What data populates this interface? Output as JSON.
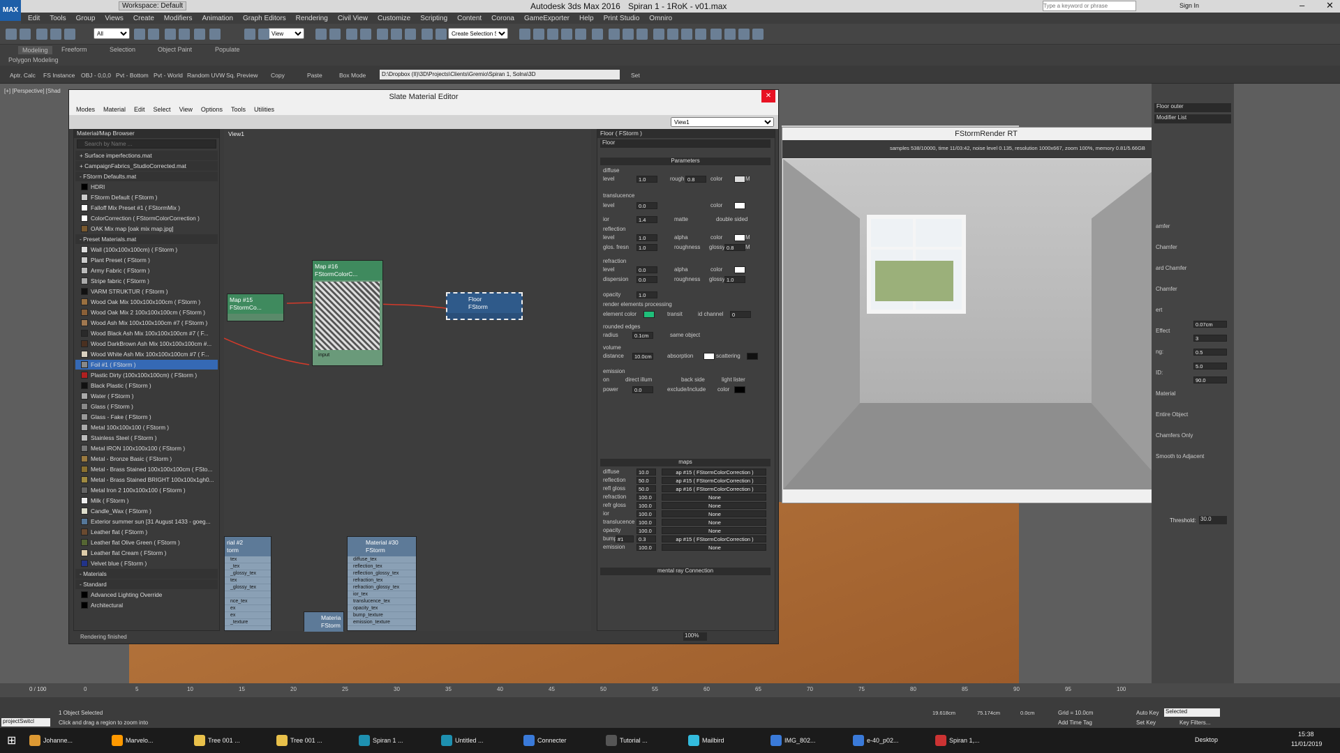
{
  "app": {
    "title": "Autodesk 3ds Max 2016",
    "file": "Spiran 1 - 1RoK - v01.max",
    "workspace": "Workspace: Default",
    "search_placeholder": "Type a keyword or phrase",
    "sign_in": "Sign In",
    "logo": "MAX"
  },
  "menubar": [
    "Edit",
    "Tools",
    "Group",
    "Views",
    "Create",
    "Modifiers",
    "Animation",
    "Graph Editors",
    "Rendering",
    "Civil View",
    "Customize",
    "Scripting",
    "Content",
    "Corona",
    "GameExporter",
    "Help",
    "Print Studio",
    "Omniro"
  ],
  "toolbar": {
    "selection_filter": "All",
    "view_dropdown": "View",
    "named_selection": "Create Selection Se"
  },
  "ribbon": {
    "tabs": [
      "Modeling",
      "Freeform",
      "Selection",
      "Object Paint",
      "Populate"
    ],
    "sub": "Polygon Modeling"
  },
  "cmdbar": {
    "items": [
      "Aptr. Calc",
      "FS Instance",
      "OBJ - 0,0,0",
      "Pvt - Bottom",
      "Pvt - World",
      "Random UVW",
      "Sq. Preview",
      "Copy",
      "Paste",
      "Box Mode"
    ],
    "path": "D:\\Dropbox (II)\\3D\\Projects\\Clients\\Gremio\\Spiran 1, Solna\\3D",
    "set": "Set"
  },
  "viewport": {
    "label": "[+] [Perspective] [Shad"
  },
  "sme": {
    "title": "Slate Material Editor",
    "menu": [
      "Modes",
      "Material",
      "Edit",
      "Select",
      "View",
      "Options",
      "Tools",
      "Utilities"
    ],
    "view_dropdown": "View1",
    "browser_title": "Material/Map Browser",
    "search": "Search by Name ...",
    "view_tab": "View1",
    "status": "Rendering finished",
    "zoom": "100%",
    "browser_rows": [
      {
        "label": "+ Surface imperfections.mat",
        "type": "group"
      },
      {
        "label": "+ CampaignFabrics_StudioCorrected.mat",
        "type": "group"
      },
      {
        "label": "- FStorm Defaults.mat",
        "type": "group"
      },
      {
        "label": "HDRI",
        "type": "item",
        "color": "#000000"
      },
      {
        "label": "FStorm Default  ( FStorm )",
        "type": "item",
        "color": "#cccccc"
      },
      {
        "label": "Falloff Mix Preset #1  ( FStormMix )",
        "type": "item",
        "color": "#ffffff"
      },
      {
        "label": "ColorCorrection  ( FStormColorCorrection )",
        "type": "item",
        "color": "#ffffff"
      },
      {
        "label": "OAK Mix map [oak mix map.jpg]",
        "type": "item",
        "color": "#7a5a30"
      },
      {
        "label": "- Preset Materials.mat",
        "type": "group"
      },
      {
        "label": "Wall (100x100x100cm)  ( FStorm )",
        "type": "item",
        "color": "#dddddd"
      },
      {
        "label": "Plant Preset  ( FStorm )",
        "type": "item",
        "color": "#cccccc"
      },
      {
        "label": "Army Fabric  ( FStorm )",
        "type": "item",
        "color": "#bbbbbb"
      },
      {
        "label": "Stripe fabric  ( FStorm )",
        "type": "item",
        "color": "#aaaaaa"
      },
      {
        "label": "VARM STRUKTUR  ( FStorm )",
        "type": "item",
        "color": "#111111"
      },
      {
        "label": "Wood Oak Mix 100x100x100cm  ( FStorm )",
        "type": "item",
        "color": "#9a7040"
      },
      {
        "label": "Wood Oak Mix 2 100x100x100cm  ( FStorm )",
        "type": "item",
        "color": "#8a6038"
      },
      {
        "label": "Wood Ash Mix 100x100x100cm #7  ( FStorm )",
        "type": "item",
        "color": "#a07850"
      },
      {
        "label": "Wood Black Ash Mix 100x100x100cm #7  ( F...",
        "type": "item",
        "color": "#2a2a2a"
      },
      {
        "label": "Wood DarkBrown Ash Mix 100x100x100cm #...",
        "type": "item",
        "color": "#4a3020"
      },
      {
        "label": "Wood White Ash Mix 100x100x100cm #7  ( F...",
        "type": "item",
        "color": "#d8d0c0"
      },
      {
        "label": "Foil #1  ( FStorm )",
        "type": "item",
        "color": "#888888",
        "selected": true
      },
      {
        "label": "Plastic Dirty (100x100x100cm)  ( FStorm )",
        "type": "item",
        "color": "#b02020"
      },
      {
        "label": "Black Plastic  ( FStorm )",
        "type": "item",
        "color": "#111111"
      },
      {
        "label": "Water  ( FStorm )",
        "type": "item",
        "color": "#aaaaaa"
      },
      {
        "label": "Glass  ( FStorm )",
        "type": "item",
        "color": "#888888"
      },
      {
        "label": "Glass - Fake  ( FStorm )",
        "type": "item",
        "color": "#999999"
      },
      {
        "label": "Metal 100x100x100  ( FStorm )",
        "type": "item",
        "color": "#aaaaaa"
      },
      {
        "label": "Stainless Steel  ( FStorm )",
        "type": "item",
        "color": "#bbbbbb"
      },
      {
        "label": "Metal IRON 100x100x100  ( FStorm )",
        "type": "item",
        "color": "#777777"
      },
      {
        "label": "Metal - Bronze Basic  ( FStorm )",
        "type": "item",
        "color": "#9a7a40"
      },
      {
        "label": "Metal - Brass Stained 100x100x100cm  ( FSto...",
        "type": "item",
        "color": "#8a7030"
      },
      {
        "label": "Metal - Brass Stained BRIGHT 100x100x1gh0...",
        "type": "item",
        "color": "#a08a40"
      },
      {
        "label": "Metal Iron 2 100x100x100  ( FStorm )",
        "type": "item",
        "color": "#666666"
      },
      {
        "label": "Milk  ( FStorm )",
        "type": "item",
        "color": "#eeeeee"
      },
      {
        "label": "Candle_Wax  ( FStorm )",
        "type": "item",
        "color": "#ddddcc"
      },
      {
        "label": "Exterior summer sun [31 August 1433 - goeg...",
        "type": "item",
        "color": "#557799"
      },
      {
        "label": "Leather flat  ( FStorm )",
        "type": "item",
        "color": "#6a4a30"
      },
      {
        "label": "Leather flat  Olive Green  ( FStorm )",
        "type": "item",
        "color": "#556633"
      },
      {
        "label": "Leather flat Cream  ( FStorm )",
        "type": "item",
        "color": "#ddccaa"
      },
      {
        "label": "Velvet blue  ( FStorm )",
        "type": "item",
        "color": "#223388"
      },
      {
        "label": "- Materials",
        "type": "group"
      },
      {
        "label": "- Standard",
        "type": "group"
      },
      {
        "label": "Advanced Lighting Override",
        "type": "item",
        "color": "#000000"
      },
      {
        "label": "Architectural",
        "type": "item",
        "color": "#000000"
      }
    ],
    "nodes": {
      "map15": {
        "title": "Map #15",
        "sub": "FStormCo..."
      },
      "map16": {
        "title": "Map #16",
        "sub": "FStormColorC...",
        "input": "input"
      },
      "floor": {
        "title": "Floor",
        "sub": "FStorm"
      },
      "mat2": {
        "title": "rial #2",
        "sub": "torm",
        "slots": [
          "tex",
          "_tex",
          "_glossy_tex",
          "tex",
          "_glossy_tex",
          "",
          "nce_tex",
          "ex",
          "ex",
          "_texture"
        ]
      },
      "mat30": {
        "title": "Material #30",
        "sub": "FStorm",
        "slots": [
          "diffuse_tex",
          "reflection_tex",
          "reflection_glossy_tex",
          "refraction_tex",
          "refraction_glossy_tex",
          "ior_tex",
          "translucence_tex",
          "opacity_tex",
          "bump_texture",
          "emission_texture"
        ]
      },
      "mat_small": {
        "title": "Materia",
        "sub": "FStorm"
      }
    },
    "param_title": "Floor  ( FStorm )",
    "param_name": "Floor",
    "params": {
      "rollout": "Parameters",
      "diffuse": "diffuse",
      "level": "level",
      "level_val": "1.0",
      "rough": "rough",
      "rough_val": "0.8",
      "color": "color",
      "m": "M",
      "translucence": "translucence",
      "tl_level": "0.0",
      "ior": "ior",
      "ior_val": "1.4",
      "matte": "matte",
      "double_sided": "double sided",
      "reflection": "reflection",
      "refl_level": "1.0",
      "alpha": "alpha",
      "gloss_fresn": "glos. fresn",
      "gloss_fresn_val": "1.0",
      "roughness": "roughness",
      "glossy": "glossy",
      "glossy_val": "0.8",
      "refraction": "refraction",
      "refr_level": "0.0",
      "dispersion": "dispersion",
      "disp_val": "0.0",
      "refr_glossy": "1.0",
      "opacity": "opacity",
      "opacity_val": "1.0",
      "render_elements": "render elements processing",
      "element_color": "element color",
      "transit": "transit",
      "id_channel": "id channel",
      "id_val": "0",
      "rounded_edges": "rounded edges",
      "radius": "radius",
      "radius_val": "0.1cm",
      "same_object": "same object",
      "volume": "volume",
      "distance": "distance",
      "distance_val": "10.0cm",
      "absorption": "absorption",
      "scattering": "scattering",
      "emission": "emission",
      "on": "on",
      "direct_illum": "direct illum",
      "back_side": "back side",
      "light_lister": "light lister",
      "power": "power",
      "power_val": "0.0",
      "exclude_include": "exclude/include"
    },
    "maps_title": "maps",
    "maps": [
      {
        "name": "diffuse",
        "amount": "10.0",
        "map": "ap #15  ( FStormColorCorrection )"
      },
      {
        "name": "reflection",
        "amount": "50.0",
        "map": "ap #15  ( FStormColorCorrection )"
      },
      {
        "name": "refl gloss",
        "amount": "50.0",
        "map": "ap #16  ( FStormColorCorrection )"
      },
      {
        "name": "refraction",
        "amount": "100.0",
        "map": "None"
      },
      {
        "name": "refr gloss",
        "amount": "100.0",
        "map": "None"
      },
      {
        "name": "ior",
        "amount": "100.0",
        "map": "None"
      },
      {
        "name": "translucence",
        "amount": "100.0",
        "map": "None"
      },
      {
        "name": "opacity",
        "amount": "100.0",
        "map": "None"
      },
      {
        "name": "bump",
        "amount": "0.3",
        "map": "ap #15  ( FStormColorCorrection )",
        "extra": "#1"
      },
      {
        "name": "emission",
        "amount": "100.0",
        "map": "None"
      }
    ],
    "mental_ray": "mental ray Connection"
  },
  "fstorm": {
    "title": "FStormRender RT",
    "stats": "samples 538/10000,  time 11/03:42,  noise level 0.135,  resolution 1000x667,  zoom 100%,  memory 0.81/5.66GB"
  },
  "cmdpanel": {
    "name": "Floor outer",
    "modifier_list": "Modifier List",
    "items": [
      "amfer",
      "Chamfer",
      "ard Chamfer",
      "Chamfer",
      "ert",
      "Effect",
      "ng:",
      "ID:",
      "Material",
      "Entire Object",
      "Chamfers Only",
      "Smooth to Adjacent"
    ],
    "values": [
      "0.07cm",
      "3",
      "0.5",
      "5.0",
      "90.0"
    ],
    "threshold_label": "Threshold:",
    "threshold": "30.0"
  },
  "timeline": {
    "range": "0 / 100",
    "ticks": [
      "0",
      "5",
      "10",
      "15",
      "20",
      "25",
      "30",
      "35",
      "40",
      "45",
      "50",
      "55",
      "60",
      "65",
      "70",
      "75",
      "80",
      "85",
      "90",
      "95",
      "100"
    ]
  },
  "status": {
    "script": "projectSwitcl",
    "selected": "1 Object Selected",
    "hint": "Click and drag a region to zoom into",
    "x": "19.618cm",
    "y": "75.174cm",
    "z": "0.0cm",
    "grid": "Grid = 10.0cm",
    "add_time_tag": "Add Time Tag",
    "auto_key": "Auto Key",
    "auto_key_val": "Selected",
    "set_key": "Set Key",
    "key_filters": "Key Filters..."
  },
  "taskbar": {
    "items": [
      {
        "label": "Johanne...",
        "color": "#d93"
      },
      {
        "label": "Marvelo...",
        "color": "#f90"
      },
      {
        "label": "Tree 001 ...",
        "color": "#e8c04a"
      },
      {
        "label": "Tree 001 ...",
        "color": "#e8c04a"
      },
      {
        "label": "Spiran 1 ...",
        "color": "#1e90b0"
      },
      {
        "label": "Untitled ...",
        "color": "#1e90b0"
      },
      {
        "label": "Connecter",
        "color": "#3a7ad9"
      },
      {
        "label": "Tutorial ...",
        "color": "#555"
      },
      {
        "label": "Mailbird",
        "color": "#3bd"
      },
      {
        "label": "IMG_802...",
        "color": "#3a7ad9"
      },
      {
        "label": "e-40_p02...",
        "color": "#3a7ad9"
      },
      {
        "label": "Spiran 1,...",
        "color": "#c33"
      }
    ],
    "desktop": "Desktop",
    "time": "15:38",
    "date": "11/01/2019"
  }
}
